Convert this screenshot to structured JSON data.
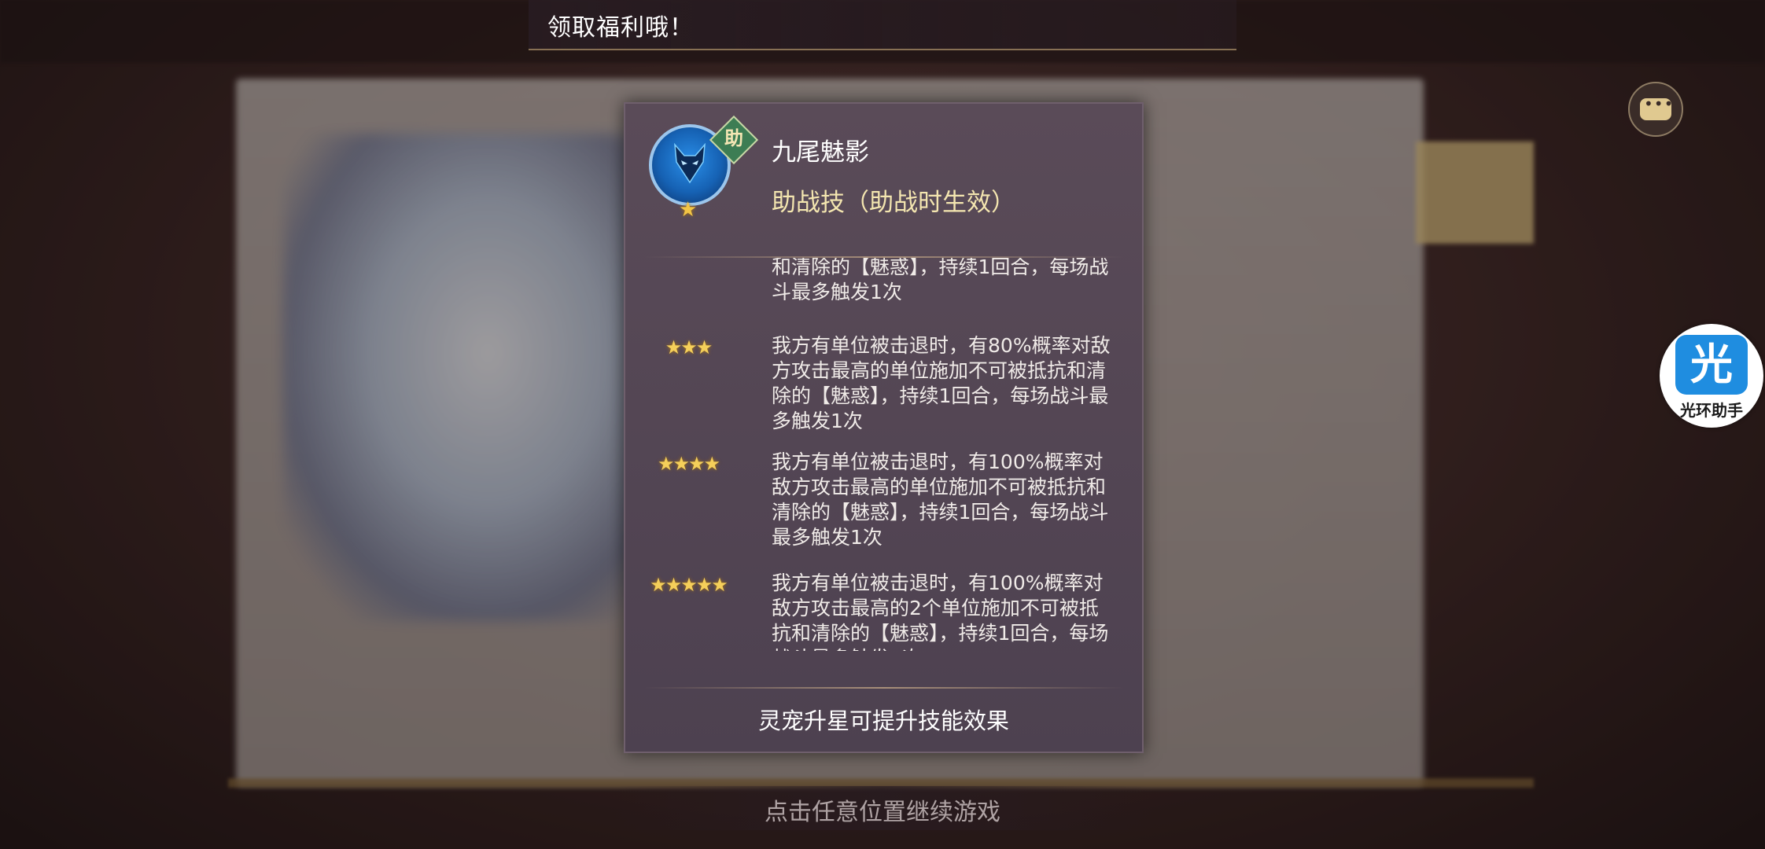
{
  "notice": {
    "text": "领取福利哦！"
  },
  "assistant": {
    "glyph": "光",
    "label": "光环助手"
  },
  "popup": {
    "skill_name": "九尾魅影",
    "skill_type": "助战技（助战时生效）",
    "helper_badge": "助",
    "tiers": [
      {
        "stars": "★★",
        "text": "对敌方攻击最高的单位施加不可被抵抗和清除的【魅惑】，持续1回合，每场战斗最多触发1次"
      },
      {
        "stars": "★★★",
        "text": "我方有单位被击退时，有80%概率对敌方攻击最高的单位施加不可被抵抗和清除的【魅惑】，持续1回合，每场战斗最多触发1次"
      },
      {
        "stars": "★★★★",
        "text": "我方有单位被击退时，有100%概率对敌方攻击最高的单位施加不可被抵抗和清除的【魅惑】，持续1回合，每场战斗最多触发1次"
      },
      {
        "stars": "★★★★★",
        "text": "我方有单位被击退时，有100%概率对敌方攻击最高的2个单位施加不可被抵抗和清除的【魅惑】，持续1回合，每场战斗最多触发1次"
      }
    ],
    "footer_hint": "灵宠升星可提升技能效果"
  },
  "continue_hint": "点击任意位置继续游戏",
  "colors": {
    "popup_bg": "#52455a",
    "accent_gold": "#f5cf5a",
    "skill_type": "#f4e6b0",
    "assist_blue": "#1f8de0"
  },
  "icons": {
    "skill": "fox-head-icon",
    "chat": "chat-bubble-icon",
    "star": "star-icon"
  }
}
